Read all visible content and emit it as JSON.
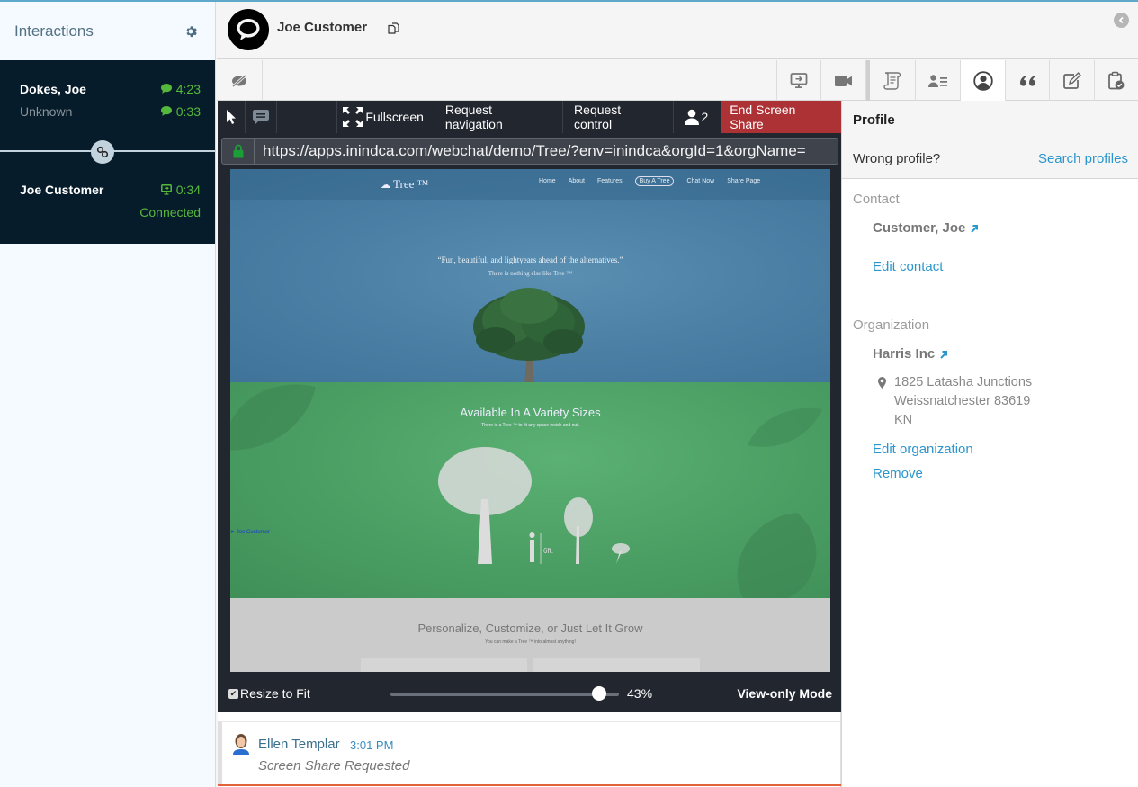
{
  "sidebar": {
    "title": "Interactions",
    "settings_icon": "gear-icon",
    "interactions": [
      {
        "name": "Dokes, Joe",
        "subtitle": "Unknown",
        "time_primary": "4:23",
        "time_secondary": "0:33",
        "channel_icon": "chat-bubble-icon"
      },
      {
        "name": "Joe Customer",
        "time_primary": "0:34",
        "status": "Connected",
        "channel_icon": "screen-share-icon"
      }
    ],
    "link_icon": "link-icon"
  },
  "header": {
    "avatar_icon": "chat-bubble-icon",
    "title": "Joe Customer",
    "copy_icon": "copy-icon",
    "collapse_icon": "chevron-left-icon"
  },
  "toolbar": {
    "left_icon": "eye-slash-icon",
    "right_icons": [
      "screen-share-icon",
      "video-camera-icon",
      "script-icon",
      "contact-list-icon",
      "profile-icon",
      "quote-icon",
      "edit-icon",
      "clipboard-check-icon"
    ],
    "active_icon": "profile-icon"
  },
  "screen_share": {
    "toolbar": {
      "pointer_icon": "cursor-icon",
      "chat_icon": "chat-icon",
      "fullscreen_label": "Fullscreen",
      "request_navigation_label": "Request navigation",
      "request_control_label": "Request control",
      "participants_count": "2",
      "end_label": "End Screen Share"
    },
    "url": "https://apps.inindca.com/webchat/demo/Tree/?env=inindca&orgId=1&orgName=",
    "page": {
      "logo": "Tree ™",
      "nav": [
        "Home",
        "About",
        "Features",
        "Buy A Tree",
        "Chat Now",
        "Share Page"
      ],
      "quote": "“Fun, beautiful, and lightyears ahead of the alternatives.”",
      "quote_sub": "There is nothing else like    Tree ™",
      "green_title": "Available In A Variety Sizes",
      "green_sub": "There is a Tree ™ to fit any space inside and out.",
      "scale_label": "6ft.",
      "remote_cursor_label": "Joe Customer",
      "gray_title": "Personalize, Customize, or Just Let It Grow",
      "gray_sub": "You can make a Tree ™ into almost anything!"
    },
    "footer": {
      "resize_label": "Resize to Fit",
      "resize_checked": true,
      "zoom_percent": 43,
      "zoom_label": "43%",
      "mode_label": "View-only Mode"
    }
  },
  "chat": {
    "messages": [
      {
        "sender": "Ellen Templar",
        "time": "3:01 PM",
        "text": "Screen Share Requested"
      }
    ]
  },
  "profile": {
    "title": "Profile",
    "wrong_profile_label": "Wrong profile?",
    "search_profiles_label": "Search profiles",
    "contact_section": "Contact",
    "contact_name": "Customer, Joe",
    "edit_contact_label": "Edit contact",
    "organization_section": "Organization",
    "organization_name": "Harris Inc",
    "address": [
      "1825 Latasha Junctions",
      "Weissnatchester 83619",
      "KN"
    ],
    "edit_organization_label": "Edit organization",
    "remove_label": "Remove"
  },
  "colors": {
    "accent_link": "#2b96cb",
    "status_green": "#56b83a",
    "end_share_red": "#ad3236",
    "sidebar_dark": "#061c2a"
  }
}
